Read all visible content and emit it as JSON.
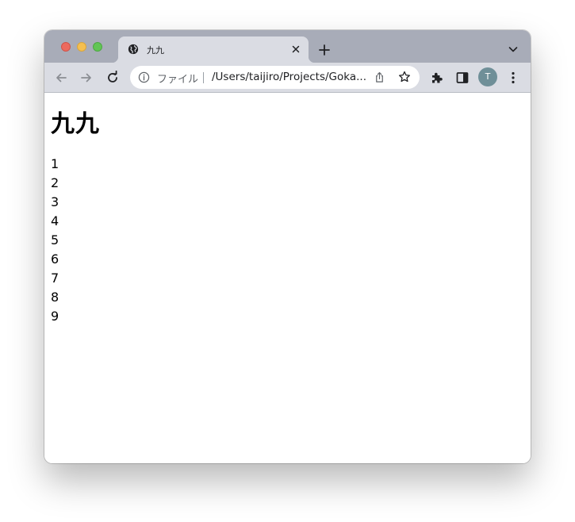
{
  "window": {
    "traffic_lights": {
      "close": "#ed6a5e",
      "minimize": "#f5bf4f",
      "maximize": "#61c554"
    }
  },
  "tab": {
    "title": "九九",
    "favicon": "globe-icon"
  },
  "toolbar": {
    "omnibox": {
      "scheme_label": "ファイル",
      "url": "/Users/taijiro/Projects/Goka..."
    },
    "profile_initial": "T",
    "profile_color": "#6f8f98"
  },
  "page": {
    "heading": "九九",
    "numbers": [
      "1",
      "2",
      "3",
      "4",
      "5",
      "6",
      "7",
      "8",
      "9"
    ]
  }
}
